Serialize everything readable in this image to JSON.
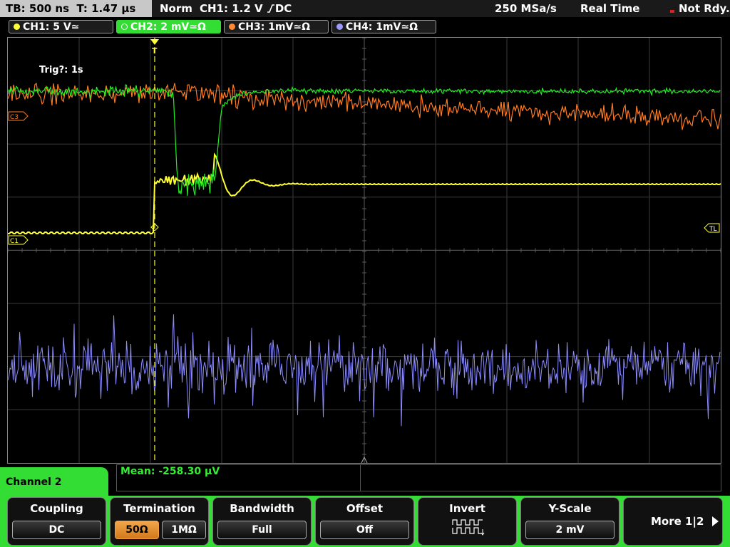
{
  "top_bar": {
    "timebase": "TB: 500 ns",
    "trigger_time": "T: 1.47 µs",
    "trigger_mode": "Norm",
    "trigger_source": "CH1: 1.2 V",
    "trigger_coupling": "DC",
    "sample_rate": "250 MSa/s",
    "acq_mode": "Real Time",
    "status": "Not Rdy."
  },
  "channel_tabs": [
    {
      "label": "CH1: 5 V",
      "suffix": "≃",
      "color": "#ffff33"
    },
    {
      "label": "CH2: 2 mV",
      "suffix": "≃Ω",
      "color": "#33dd33",
      "active": true
    },
    {
      "label": "CH3: 1mV",
      "suffix": "≃Ω",
      "color": "#ff8833"
    },
    {
      "label": "CH4: 1mV",
      "suffix": "≃Ω",
      "color": "#9a9aff"
    }
  ],
  "screen": {
    "trigger_info": "Trig?: 1s",
    "marker_c3": "C3",
    "marker_c1": "C1",
    "marker_tl": "TL",
    "marker_trigger": "T"
  },
  "measurement": {
    "mean": "Mean: -258.30 µV"
  },
  "menu": {
    "title": "Channel 2",
    "softkeys": [
      {
        "title": "Coupling",
        "value": "DC"
      },
      {
        "title": "Termination",
        "options": [
          "50Ω",
          "1MΩ"
        ],
        "selected": "50Ω"
      },
      {
        "title": "Bandwidth",
        "value": "Full"
      },
      {
        "title": "Offset",
        "value": "Off"
      },
      {
        "title": "Invert",
        "icon": "invert-waveform-icon"
      },
      {
        "title": "Y-Scale",
        "value": "2 mV"
      },
      {
        "title": "More 1|2"
      }
    ]
  }
}
